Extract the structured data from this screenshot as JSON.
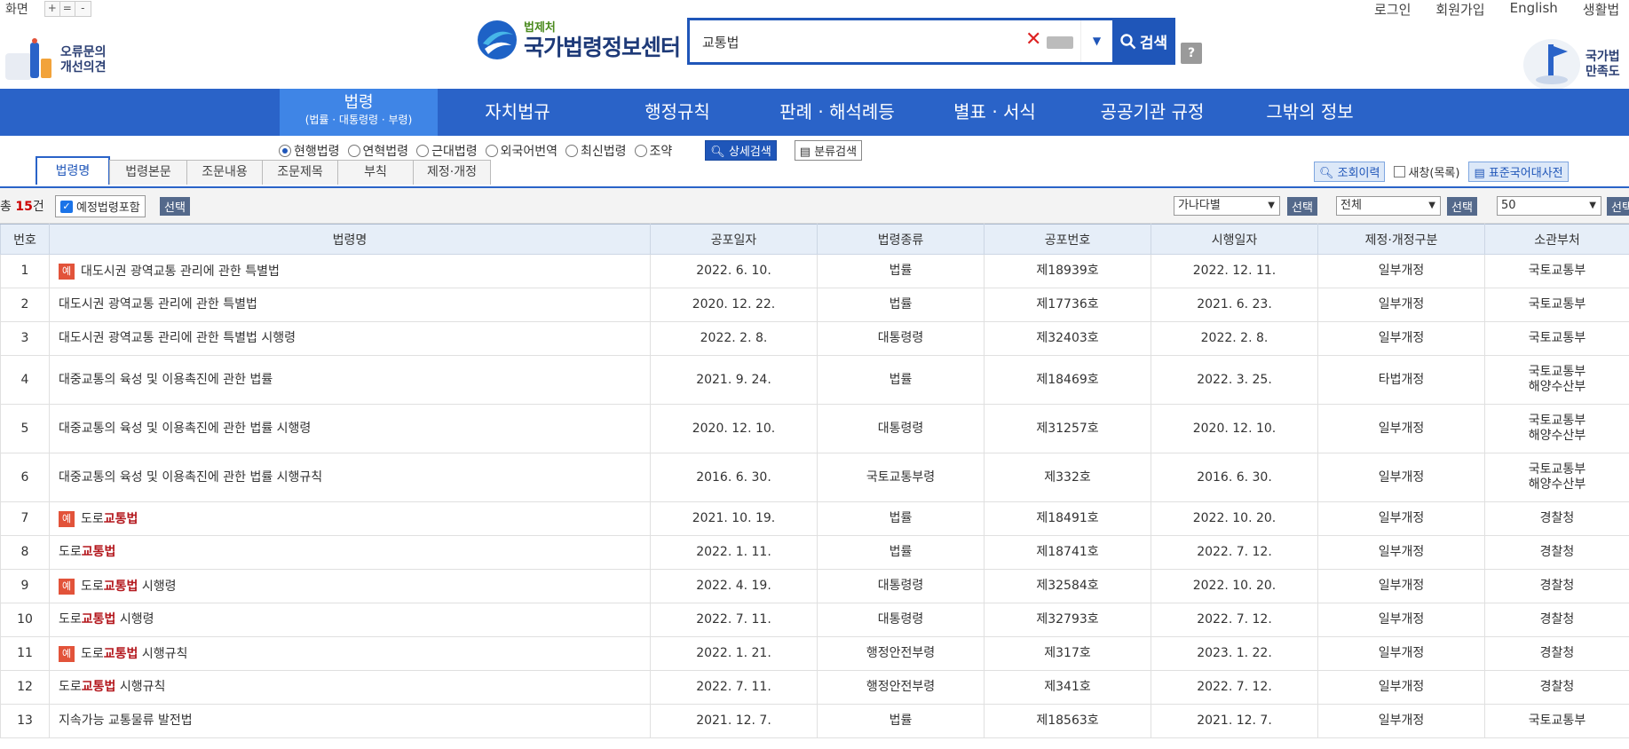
{
  "top": {
    "zoom_label": "화면",
    "zoom_buttons": [
      "+",
      "=",
      "-"
    ],
    "opinion_line1": "오류문의",
    "opinion_line2": "개선의견",
    "logo_sub": "법제처",
    "logo_main": "국가법령정보센터",
    "search_value": "교통법",
    "search_button": "검색",
    "help": "?",
    "links": [
      "로그인",
      "회원가입",
      "English",
      "생활법"
    ],
    "satisfy_line1": "국가법",
    "satisfy_line2": "만족도"
  },
  "nav": {
    "items": [
      "법령",
      "자치법규",
      "행정규칙",
      "판례 · 해석례등",
      "별표 · 서식",
      "공공기관 규정",
      "그밖의 정보"
    ],
    "active_sub": "(법률 · 대통령령 · 부령)"
  },
  "options": {
    "radios": [
      "현행법령",
      "연혁법령",
      "근대법령",
      "외국어번역",
      "최신법령",
      "조약"
    ],
    "detail_search": "상세검색",
    "class_search": "분류검색"
  },
  "tabs": [
    "법령명",
    "법령본문",
    "조문내용",
    "조문제목",
    "부칙",
    "제정·개정문"
  ],
  "rtools": {
    "history": "조회이력",
    "newwin": "새창(목록)",
    "dict": "표준국어대사전"
  },
  "countrow": {
    "count_prefix": "총",
    "count": "15",
    "count_suffix": "건",
    "planned": "예정법령포함",
    "select": "선택",
    "sort_value": "가나다별",
    "filter_value": "전체",
    "page_size": "50"
  },
  "table": {
    "headers": [
      "번호",
      "법령명",
      "공포일자",
      "법령종류",
      "공포번호",
      "시행일자",
      "제정·개정구분",
      "소관부처"
    ],
    "tag": "예",
    "rows": [
      {
        "no": "1",
        "tag": true,
        "pre": "대도시권 광역교통 관리에 관한 특별법",
        "hl": "",
        "post": "",
        "date": "2022. 6. 10.",
        "kind": "법률",
        "num": "제18939호",
        "eff": "2022. 12. 11.",
        "type": "일부개정",
        "dept": "국토교통부",
        "dept2": ""
      },
      {
        "no": "2",
        "tag": false,
        "pre": "대도시권 광역교통 관리에 관한 특별법",
        "hl": "",
        "post": "",
        "date": "2020. 12. 22.",
        "kind": "법률",
        "num": "제17736호",
        "eff": "2021. 6. 23.",
        "type": "일부개정",
        "dept": "국토교통부",
        "dept2": ""
      },
      {
        "no": "3",
        "tag": false,
        "pre": "대도시권 광역교통 관리에 관한 특별법 시행령",
        "hl": "",
        "post": "",
        "date": "2022. 2. 8.",
        "kind": "대통령령",
        "num": "제32403호",
        "eff": "2022. 2. 8.",
        "type": "일부개정",
        "dept": "국토교통부",
        "dept2": ""
      },
      {
        "no": "4",
        "tag": false,
        "pre": "대중교통의 육성 및 이용촉진에 관한 법률",
        "hl": "",
        "post": "",
        "date": "2021. 9. 24.",
        "kind": "법률",
        "num": "제18469호",
        "eff": "2022. 3. 25.",
        "type": "타법개정",
        "dept": "국토교통부",
        "dept2": "해양수산부"
      },
      {
        "no": "5",
        "tag": false,
        "pre": "대중교통의 육성 및 이용촉진에 관한 법률 시행령",
        "hl": "",
        "post": "",
        "date": "2020. 12. 10.",
        "kind": "대통령령",
        "num": "제31257호",
        "eff": "2020. 12. 10.",
        "type": "일부개정",
        "dept": "국토교통부",
        "dept2": "해양수산부"
      },
      {
        "no": "6",
        "tag": false,
        "pre": "대중교통의 육성 및 이용촉진에 관한 법률 시행규칙",
        "hl": "",
        "post": "",
        "date": "2016. 6. 30.",
        "kind": "국토교통부령",
        "num": "제332호",
        "eff": "2016. 6. 30.",
        "type": "일부개정",
        "dept": "국토교통부",
        "dept2": "해양수산부"
      },
      {
        "no": "7",
        "tag": true,
        "pre": "도로",
        "hl": "교통법",
        "post": "",
        "date": "2021. 10. 19.",
        "kind": "법률",
        "num": "제18491호",
        "eff": "2022. 10. 20.",
        "type": "일부개정",
        "dept": "경찰청",
        "dept2": ""
      },
      {
        "no": "8",
        "tag": false,
        "pre": "도로",
        "hl": "교통법",
        "post": "",
        "date": "2022. 1. 11.",
        "kind": "법률",
        "num": "제18741호",
        "eff": "2022. 7. 12.",
        "type": "일부개정",
        "dept": "경찰청",
        "dept2": ""
      },
      {
        "no": "9",
        "tag": true,
        "pre": "도로",
        "hl": "교통법",
        "post": " 시행령",
        "date": "2022. 4. 19.",
        "kind": "대통령령",
        "num": "제32584호",
        "eff": "2022. 10. 20.",
        "type": "일부개정",
        "dept": "경찰청",
        "dept2": ""
      },
      {
        "no": "10",
        "tag": false,
        "pre": "도로",
        "hl": "교통법",
        "post": " 시행령",
        "date": "2022. 7. 11.",
        "kind": "대통령령",
        "num": "제32793호",
        "eff": "2022. 7. 12.",
        "type": "일부개정",
        "dept": "경찰청",
        "dept2": ""
      },
      {
        "no": "11",
        "tag": true,
        "pre": "도로",
        "hl": "교통법",
        "post": " 시행규칙",
        "date": "2022. 1. 21.",
        "kind": "행정안전부령",
        "num": "제317호",
        "eff": "2023. 1. 22.",
        "type": "일부개정",
        "dept": "경찰청",
        "dept2": ""
      },
      {
        "no": "12",
        "tag": false,
        "pre": "도로",
        "hl": "교통법",
        "post": " 시행규칙",
        "date": "2022. 7. 11.",
        "kind": "행정안전부령",
        "num": "제341호",
        "eff": "2022. 7. 12.",
        "type": "일부개정",
        "dept": "경찰청",
        "dept2": ""
      },
      {
        "no": "13",
        "tag": false,
        "pre": "지속가능 교통물류 발전법",
        "hl": "",
        "post": "",
        "date": "2021. 12. 7.",
        "kind": "법률",
        "num": "제18563호",
        "eff": "2021. 12. 7.",
        "type": "일부개정",
        "dept": "국토교통부",
        "dept2": ""
      }
    ]
  }
}
